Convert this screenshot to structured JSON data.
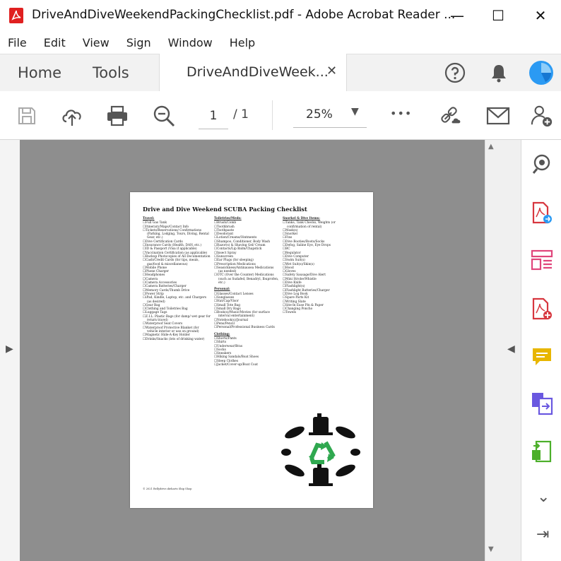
{
  "window": {
    "title": "DriveAndDiveWeekendPackingChecklist.pdf - Adobe Acrobat Reader ...",
    "minimize": "—",
    "maximize": "☐",
    "close": "✕"
  },
  "menu": [
    "File",
    "Edit",
    "View",
    "Sign",
    "Window",
    "Help"
  ],
  "tabs": {
    "home": "Home",
    "tools": "Tools",
    "document": "DriveAndDiveWeek...",
    "close": "✕"
  },
  "toolbar": {
    "page_current": "1",
    "page_total": "/ 1",
    "zoom": "25%",
    "zoom_caret": "▼",
    "more": "•••"
  },
  "icons": {
    "save": "save-icon",
    "upload": "upload-cloud-icon",
    "print": "print-icon",
    "zoom_out": "zoom-out-icon",
    "share_link": "link-icon",
    "email": "envelope-icon",
    "add_user": "add-user-icon",
    "help": "help-icon",
    "notifications": "bell-icon",
    "account": "avatar-icon"
  },
  "arrows": {
    "left": "▶",
    "right": "◀",
    "up": "▲",
    "down": "▼",
    "chevron": "⌄",
    "exit": "⇥"
  },
  "colors": {
    "accent_blue": "#2b9af3",
    "pdf_red": "#d7373f",
    "tool_pink": "#e0457b",
    "tool_yellow": "#e8b600",
    "tool_purple": "#6a58e0",
    "tool_green": "#4caf2a",
    "recycle_green": "#2fa84f"
  },
  "pdf": {
    "title": "Drive and Dive Weekend SCUBA Packing Checklist",
    "col1_heading": "Travel:",
    "col1_items": [
      "Full Gas Tank",
      "Itinerary/Maps/Contact Info",
      "Tickets/Reservations/ Confirmations (Parking, Lodging, Tours, Diving, Rental Gear, etc.)",
      "Dive Certification Cards",
      "Insurance Cards (Health, DAN, etc.)",
      "ID & Passport (Visa if applicable)",
      "Vaccination Certification (as applicable)",
      "Backup Photocopies of All Documentation",
      "Cash/Credit Cards (for tips, meals, gas/food & miscellaneous)",
      "Mobile Phone",
      "Phone Charger",
      "Headphones",
      "Camera",
      "Camera Accessories",
      "Camera Batteries/Charger",
      "Memory Cards/Thumb Drive",
      "Power Strip",
      "iPad, Kindle, Laptop, etc. and Chargers (as desired)",
      "Gear Bag",
      "Clothing and Toiletries Bag",
      "Luggage Tags",
      "Z.I.L. Plastic Bags (for damp/ wet gear for return travel)",
      "Waterproof Seat Covers",
      "Waterproof Protective Blanket (for vehicle interior or use on ground)",
      "Magnetic Hide-A-Key Holder",
      "Drinks/Snacks (lots of drinking water)"
    ],
    "col2_heading1": "Toiletries/Meds:",
    "col2_items1": [
      "Brush/Comb",
      "Toothbrush",
      "Toothpaste",
      "Deodorant",
      "Lotion/Creams/Ointments",
      "Shampoo, Conditioner, Body Wash",
      "Razor(s) & Shaving Gel/ Cream",
      "Contacts/Lip Balm/Chapstick",
      "Insect Spray",
      "Sunscreen",
      "Ear Plugs (for sleeping)",
      "Prescription Medications",
      "Seasickness/Antinausea Medications (as needed)",
      "OTC (Over the Counter) Medications (such as Sudafed, Benadryl, Ibuprofen, etc.)"
    ],
    "col2_heading2": "Personal:",
    "col2_items2": [
      "Glasses/Contact Lenses",
      "Sunglasses",
      "Hat/Cap/Visor",
      "Small Tote Bag",
      "Small Dry Bags",
      "Book(s)/Music/Movies (for surface interval entertainment)",
      "Notebook(s)/Journal",
      "Pens/Pencil",
      "Personal/Professional Business Cards"
    ],
    "col2_heading3": "Clothing:",
    "col2_items3": [
      "Shorts/Pants",
      "Shirts",
      "Underwear/Bras",
      "Socks",
      "Sneakers",
      "Hiking Sandals/Boat Shoes",
      "Sleep Clothes",
      "Jacket/Cover-up/Boat Coat"
    ],
    "col3_heading": "Snorkel & Dive Items:",
    "col3_items": [
      "Tanks, Tank Checks, Weights (or confirmation of rental)",
      "Mask(s)",
      "Snorkel",
      "Fins",
      "Dive Booties/Boots/Socks",
      "Defog, Saline Eye, Eye Drops",
      "BC",
      "Regulator",
      "Dive Computer",
      "Swim Suit(s)",
      "Wet Suit(s)/Skin(s)",
      "Hood",
      "Gloves",
      "Safety Sausage/Dive Alert",
      "Mini Strobe/Whistle",
      "Dive Knife",
      "Flashlight(s)",
      "Flashlight Batteries/Charger",
      "Dive Log Book",
      "Spare Parts Kit",
      "Writing Slate",
      "Site-In Ease Pin & Paper",
      "Changing Poncho",
      "Towels"
    ],
    "footer": "© 2021 Bellydrive.dieharts Ship Shop"
  }
}
